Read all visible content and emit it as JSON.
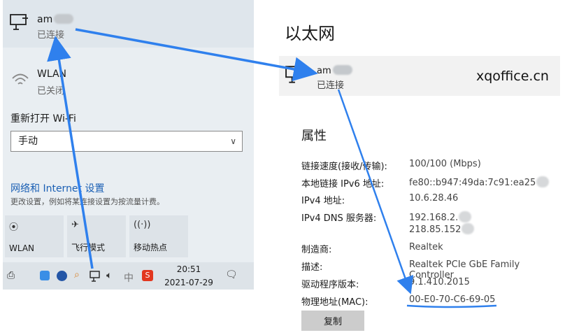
{
  "flyout": {
    "ethernet": {
      "name": "am",
      "status": "已连接"
    },
    "wlan": {
      "name": "WLAN",
      "status": "已关闭"
    },
    "reopen_label": "重新打开 Wi-Fi",
    "reopen_value": "手动",
    "settings_link": "网络和 Internet 设置",
    "settings_hint": "更改设置，例如将某连接设置为按流量计费。",
    "tiles": [
      {
        "label": "WLAN",
        "icon": "wifi-icon"
      },
      {
        "label": "飞行模式",
        "icon": "airplane-icon"
      },
      {
        "label": "移动热点",
        "icon": "hotspot-icon"
      }
    ]
  },
  "taskbar": {
    "time": "20:51",
    "date": "2021-07-29"
  },
  "page": {
    "title": "以太网",
    "card_name": "am",
    "card_status": "已连接",
    "watermark": "xqoffice.cn",
    "properties_heading": "属性",
    "properties": [
      {
        "label": "链接速度(接收/传输):",
        "value": "100/100 (Mbps)"
      },
      {
        "label": "本地链接 IPv6 地址:",
        "value": "fe80::b947:49da:7c91:ea25"
      },
      {
        "label": "IPv4 地址:",
        "value": "10.6.28.46"
      },
      {
        "label": "IPv4 DNS 服务器:",
        "value": "192.168.2.",
        "value2": "218.85.152"
      },
      {
        "label": "制造商:",
        "value": "Realtek"
      },
      {
        "label": "描述:",
        "value": "Realtek PCIe GbE Family Controller"
      },
      {
        "label": "驱动程序版本:",
        "value": "9.1.410.2015"
      },
      {
        "label": "物理地址(MAC):",
        "value": "00-E0-70-C6-69-05"
      }
    ],
    "copy_button": "复制"
  },
  "colors": {
    "arrow": "#2f80ed",
    "link": "#1a5fb4",
    "tile_bg": "#dde3e8"
  }
}
